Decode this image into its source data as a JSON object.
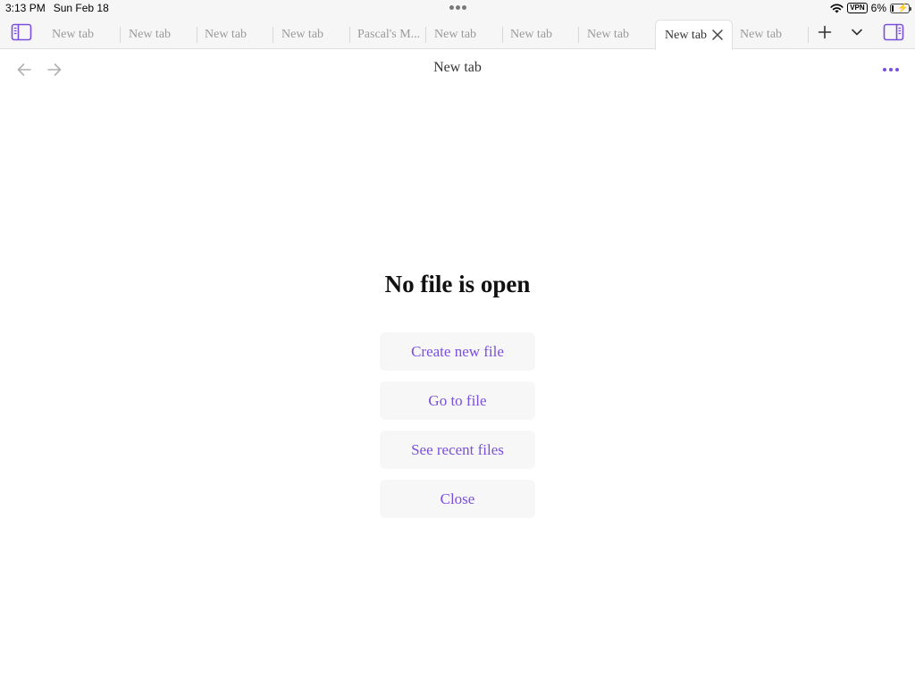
{
  "status_bar": {
    "time": "3:13 PM",
    "date": "Sun Feb 18",
    "vpn": "VPN",
    "battery": "6%"
  },
  "tabs": [
    {
      "label": "New tab",
      "active": false
    },
    {
      "label": "New tab",
      "active": false
    },
    {
      "label": "New tab",
      "active": false
    },
    {
      "label": "New tab",
      "active": false
    },
    {
      "label": "Pascal's M...",
      "active": false
    },
    {
      "label": "New tab",
      "active": false
    },
    {
      "label": "New tab",
      "active": false
    },
    {
      "label": "New tab",
      "active": false
    },
    {
      "label": "New tab",
      "active": true
    },
    {
      "label": "New tab",
      "active": false
    }
  ],
  "nav": {
    "title": "New tab"
  },
  "empty_state": {
    "title": "No file is open",
    "actions": [
      "Create new file",
      "Go to file",
      "See recent files",
      "Close"
    ]
  },
  "colors": {
    "accent": "#7a4fdc",
    "tab_bar_bg": "#f6f6f6",
    "button_bg": "#f7f7f7"
  },
  "icons": {
    "left_sidebar": "sidebar-left-icon",
    "right_sidebar": "sidebar-right-icon",
    "new_tab": "plus-icon",
    "tab_list": "chevron-down-icon",
    "back": "arrow-left-icon",
    "forward": "arrow-right-icon",
    "more": "more-horizontal-icon",
    "close_tab": "close-icon"
  }
}
